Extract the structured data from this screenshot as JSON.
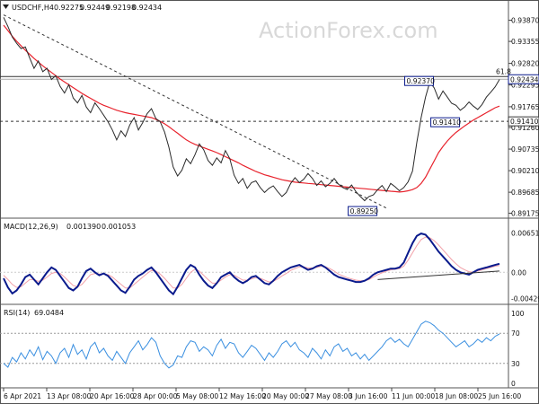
{
  "main_panel": {
    "symbol_label": "USDCHF,H4",
    "ohlc": [
      "0.92275",
      "0.92449",
      "0.92198",
      "0.92434"
    ],
    "watermark": "ActionForex.com",
    "price_ticks": [
      "0.93870",
      "0.93355",
      "0.92820",
      "0.92295",
      "0.91765",
      "0.91260",
      "0.90735",
      "0.90210",
      "0.89685",
      "0.89175"
    ],
    "current_price_label": "0.92434",
    "level_label": "0.91410",
    "fib_label": "61.8",
    "annotations": [
      "0.92370",
      "0.91410",
      "0.89250"
    ]
  },
  "macd_panel": {
    "label": "MACD(12,26,9)",
    "values": [
      "0.001390",
      "0.001053"
    ],
    "ticks": [
      "0.006511",
      "0.00",
      "-0.004298"
    ]
  },
  "rsi_panel": {
    "label": "RSI(14)",
    "value": "69.0484",
    "ticks": [
      "100",
      "70",
      "30",
      "0"
    ]
  },
  "time_axis": [
    "6 Apr 2021",
    "13 Apr 08:00",
    "20 Apr 16:00",
    "28 Apr 00:00",
    "5 May 08:00",
    "12 May 16:00",
    "20 May 00:00",
    "27 May 08:00",
    "3 Jun 16:00",
    "11 Jun 00:00",
    "18 Jun 08:00",
    "25 Jun 16:00"
  ],
  "colors": {
    "price_line": "#2a2a2a",
    "moving_average": "#e8232d",
    "macd_line": "#0a1a8c",
    "signal_line": "#f2a0a8",
    "rsi_line": "#3a8fe0",
    "current_price_box": "#0a1a8c"
  },
  "chart_data": [
    {
      "type": "line",
      "panel": "price",
      "ylim": [
        0.8912,
        0.941
      ],
      "y_ticks": [
        0.9387,
        0.93355,
        0.9282,
        0.92295,
        0.91765,
        0.9126,
        0.90735,
        0.9021,
        0.89685,
        0.89175
      ],
      "x_labels": [
        "6 Apr 2021",
        "13 Apr 08:00",
        "20 Apr 16:00",
        "28 Apr 00:00",
        "5 May 08:00",
        "12 May 16:00",
        "20 May 00:00",
        "27 May 08:00",
        "3 Jun 16:00",
        "11 Jun 00:00",
        "18 Jun 08:00",
        "25 Jun 16:00"
      ],
      "series": [
        {
          "name": "USDCHF,H4",
          "values": [
            0.9394,
            0.9372,
            0.9346,
            0.9331,
            0.9318,
            0.9322,
            0.9295,
            0.927,
            0.9288,
            0.9262,
            0.927,
            0.9243,
            0.9252,
            0.9226,
            0.921,
            0.923,
            0.9198,
            0.9186,
            0.9204,
            0.9176,
            0.9162,
            0.9186,
            0.9172,
            0.9156,
            0.914,
            0.912,
            0.9096,
            0.9118,
            0.9104,
            0.9132,
            0.915,
            0.912,
            0.9138,
            0.916,
            0.9172,
            0.9148,
            0.914,
            0.9115,
            0.9078,
            0.903,
            0.9008,
            0.9022,
            0.905,
            0.9038,
            0.906,
            0.9086,
            0.9072,
            0.9046,
            0.9034,
            0.9052,
            0.904,
            0.907,
            0.905,
            0.901,
            0.899,
            0.9002,
            0.8978,
            0.8992,
            0.8996,
            0.898,
            0.8968,
            0.8978,
            0.8984,
            0.897,
            0.8958,
            0.8968,
            0.899,
            0.9004,
            0.8992,
            0.9,
            0.9014,
            0.9002,
            0.8985,
            0.8996,
            0.8982,
            0.899,
            0.9002,
            0.8988,
            0.898,
            0.8975,
            0.8986,
            0.897,
            0.8958,
            0.8948,
            0.8958,
            0.8962,
            0.8975,
            0.8985,
            0.897,
            0.899,
            0.8982,
            0.8972,
            0.898,
            0.8994,
            0.902,
            0.909,
            0.915,
            0.92,
            0.9237,
            0.9222,
            0.9195,
            0.9215,
            0.92,
            0.9185,
            0.918,
            0.9168,
            0.9176,
            0.9188,
            0.9178,
            0.917,
            0.9182,
            0.92,
            0.9212,
            0.9225,
            0.9243
          ]
        },
        {
          "name": "Moving average",
          "values": [
            0.9375,
            0.9362,
            0.9348,
            0.9336,
            0.9325,
            0.9314,
            0.9304,
            0.9294,
            0.9285,
            0.9276,
            0.9268,
            0.926,
            0.9252,
            0.9244,
            0.9237,
            0.923,
            0.9223,
            0.9216,
            0.9209,
            0.9203,
            0.9197,
            0.9191,
            0.9185,
            0.918,
            0.9176,
            0.9172,
            0.9168,
            0.9165,
            0.9162,
            0.916,
            0.9158,
            0.9156,
            0.9154,
            0.9152,
            0.915,
            0.9146,
            0.9141,
            0.9135,
            0.9128,
            0.912,
            0.9112,
            0.9104,
            0.9096,
            0.909,
            0.9085,
            0.9081,
            0.9077,
            0.9073,
            0.9069,
            0.9065,
            0.906,
            0.9055,
            0.905,
            0.9045,
            0.904,
            0.9034,
            0.9029,
            0.9024,
            0.9019,
            0.9015,
            0.9011,
            0.9008,
            0.9005,
            0.9002,
            0.8999,
            0.8997,
            0.8995,
            0.8993,
            0.8992,
            0.8991,
            0.899,
            0.8989,
            0.8988,
            0.8987,
            0.8986,
            0.8985,
            0.8984,
            0.8983,
            0.8982,
            0.8981,
            0.898,
            0.8979,
            0.8978,
            0.8977,
            0.8976,
            0.8975,
            0.8974,
            0.8973,
            0.8972,
            0.8971,
            0.897,
            0.8969,
            0.897,
            0.8972,
            0.8975,
            0.898,
            0.899,
            0.9005,
            0.9025,
            0.9045,
            0.9065,
            0.908,
            0.9093,
            0.9104,
            0.9114,
            0.9122,
            0.913,
            0.9137,
            0.9144,
            0.915,
            0.9156,
            0.9162,
            0.9168,
            0.9174,
            0.9178
          ]
        }
      ],
      "horizontal_levels": [
        0.925,
        0.92434,
        0.9141
      ],
      "level_labels": [
        "61.8",
        "0.92434",
        "0.91410"
      ],
      "trendline_from": [
        0,
        0.94
      ],
      "trendline_to": [
        88,
        0.893
      ],
      "annotations": [
        {
          "label": "0.92370",
          "x_index": 98,
          "y": 0.9237
        },
        {
          "label": "0.91410",
          "x_index": 104,
          "y": 0.9141
        },
        {
          "label": "0.89250",
          "x_index": 85,
          "y": 0.8925
        }
      ]
    },
    {
      "type": "line",
      "panel": "macd",
      "ylim": [
        -0.005,
        0.007
      ],
      "y_ticks": [
        0.006511,
        0.0,
        -0.004298
      ],
      "series": [
        {
          "name": "MACD(12,26,9)",
          "values": [
            -0.001,
            -0.0025,
            -0.0035,
            -0.003,
            -0.002,
            -0.0008,
            -0.0004,
            -0.0012,
            -0.002,
            -0.001,
            0.0,
            0.0008,
            0.0004,
            -0.0006,
            -0.0016,
            -0.0026,
            -0.003,
            -0.0024,
            -0.001,
            0.0002,
            0.0006,
            0.0,
            -0.0005,
            -0.0002,
            -0.0006,
            -0.0014,
            -0.0022,
            -0.003,
            -0.0034,
            -0.0024,
            -0.0012,
            -0.0006,
            -0.0002,
            0.0004,
            0.0008,
            0.0,
            -0.001,
            -0.002,
            -0.003,
            -0.0036,
            -0.0024,
            -0.001,
            0.0004,
            0.0012,
            0.0008,
            -0.0004,
            -0.0014,
            -0.0022,
            -0.0026,
            -0.0018,
            -0.0008,
            -0.0004,
            0.0,
            -0.0008,
            -0.0014,
            -0.0018,
            -0.0014,
            -0.0008,
            -0.0006,
            -0.0012,
            -0.0018,
            -0.002,
            -0.0014,
            -0.0006,
            0.0,
            0.0004,
            0.0008,
            0.001,
            0.0012,
            0.0008,
            0.0004,
            0.0006,
            0.001,
            0.0012,
            0.0008,
            0.0002,
            -0.0004,
            -0.0008,
            -0.001,
            -0.0012,
            -0.0014,
            -0.0016,
            -0.0016,
            -0.0014,
            -0.001,
            -0.0004,
            0.0,
            0.0002,
            0.0004,
            0.0006,
            0.0006,
            0.0008,
            0.0016,
            0.0032,
            0.0048,
            0.006,
            0.0064,
            0.0062,
            0.0054,
            0.0044,
            0.0034,
            0.0026,
            0.0018,
            0.001,
            0.0004,
            0.0,
            -0.0002,
            -0.0004,
            0.0,
            0.0004,
            0.0006,
            0.0008,
            0.001,
            0.0012,
            0.0014
          ]
        },
        {
          "name": "Signal",
          "values": [
            -0.0005,
            -0.0012,
            -0.002,
            -0.0025,
            -0.0024,
            -0.0018,
            -0.0012,
            -0.0012,
            -0.0015,
            -0.0013,
            -0.0008,
            -0.0002,
            0.0,
            -0.0002,
            -0.0008,
            -0.0015,
            -0.0022,
            -0.0024,
            -0.002,
            -0.0012,
            -0.0004,
            -0.0002,
            -0.0003,
            -0.0003,
            -0.0004,
            -0.0008,
            -0.0014,
            -0.002,
            -0.0026,
            -0.0026,
            -0.002,
            -0.0014,
            -0.0008,
            -0.0002,
            0.0003,
            0.0002,
            -0.0003,
            -0.001,
            -0.0018,
            -0.0026,
            -0.0026,
            -0.002,
            -0.001,
            0.0,
            0.0005,
            0.0002,
            -0.0005,
            -0.0012,
            -0.0018,
            -0.0018,
            -0.0013,
            -0.0008,
            -0.0004,
            -0.0005,
            -0.0009,
            -0.0013,
            -0.0013,
            -0.0011,
            -0.0009,
            -0.001,
            -0.0013,
            -0.0016,
            -0.0015,
            -0.0011,
            -0.0006,
            -0.0002,
            0.0003,
            0.0006,
            0.0009,
            0.0009,
            0.0007,
            0.0007,
            0.0008,
            0.001,
            0.0009,
            0.0006,
            0.0002,
            -0.0003,
            -0.0006,
            -0.0009,
            -0.0011,
            -0.0013,
            -0.0014,
            -0.0014,
            -0.0012,
            -0.0008,
            -0.0004,
            -0.0001,
            0.0002,
            0.0004,
            0.0005,
            0.0006,
            0.001,
            0.002,
            0.0032,
            0.0044,
            0.0054,
            0.0058,
            0.0057,
            0.0052,
            0.0045,
            0.0037,
            0.0029,
            0.0021,
            0.0014,
            0.0008,
            0.0004,
            0.0001,
            0.0,
            0.0002,
            0.0004,
            0.0006,
            0.0008,
            0.001,
            0.0011
          ]
        }
      ],
      "trendline_from": [
        86,
        -0.0012
      ],
      "trendline_to": [
        114,
        0.0002
      ]
    },
    {
      "type": "line",
      "panel": "rsi",
      "ylim": [
        0,
        100
      ],
      "y_ticks": [
        100,
        70,
        30,
        0
      ],
      "series": [
        {
          "name": "RSI(14)",
          "values": [
            30,
            25,
            38,
            32,
            44,
            36,
            48,
            40,
            52,
            35,
            46,
            40,
            30,
            44,
            50,
            38,
            55,
            42,
            48,
            36,
            52,
            58,
            44,
            50,
            40,
            34,
            46,
            38,
            30,
            44,
            52,
            60,
            48,
            55,
            64,
            58,
            40,
            30,
            24,
            28,
            40,
            38,
            52,
            60,
            58,
            46,
            52,
            48,
            40,
            54,
            62,
            50,
            58,
            56,
            44,
            38,
            46,
            54,
            50,
            42,
            34,
            44,
            38,
            46,
            56,
            60,
            52,
            58,
            48,
            44,
            38,
            50,
            44,
            36,
            48,
            40,
            52,
            56,
            46,
            50,
            40,
            44,
            36,
            42,
            34,
            40,
            46,
            52,
            60,
            64,
            58,
            62,
            56,
            52,
            62,
            72,
            82,
            86,
            84,
            80,
            74,
            70,
            64,
            58,
            52,
            56,
            60,
            52,
            56,
            62,
            58,
            64,
            60,
            66,
            69
          ]
        }
      ],
      "levels": [
        70,
        30
      ]
    }
  ]
}
